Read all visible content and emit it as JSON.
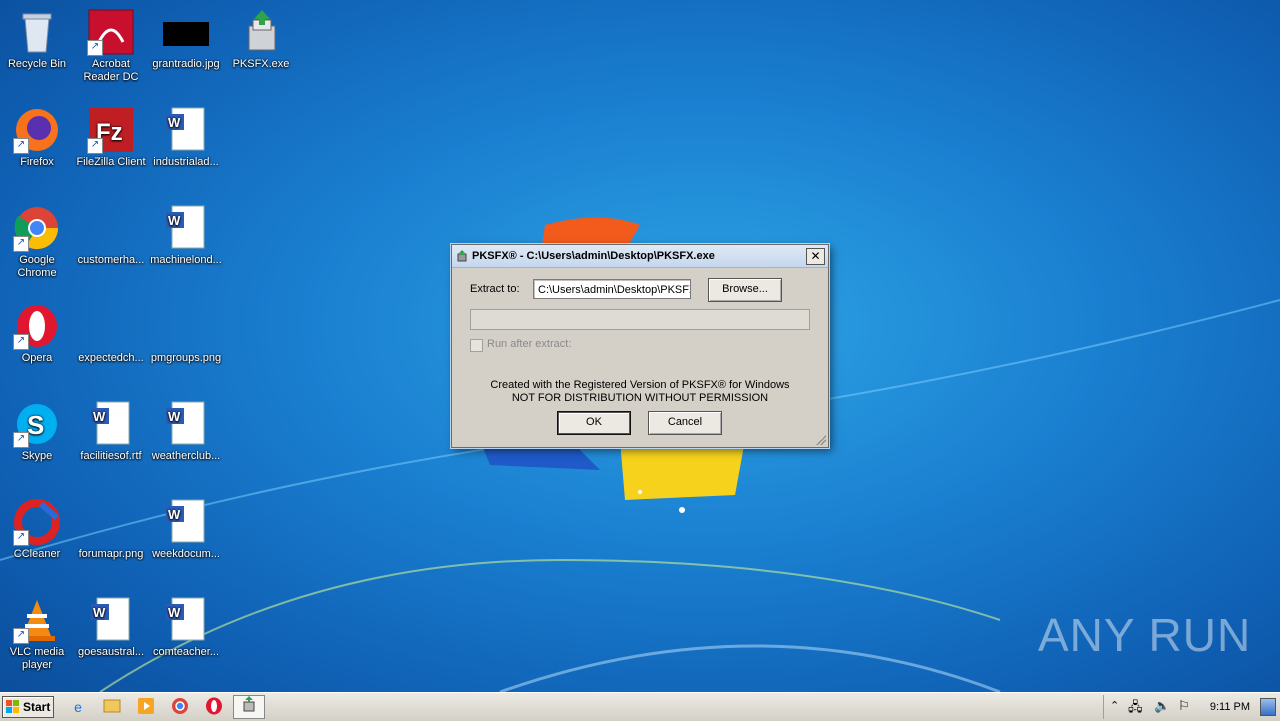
{
  "desktop": {
    "icons": [
      {
        "label": "Recycle Bin",
        "icon": "recycle-bin-icon"
      },
      {
        "label": "Acrobat Reader DC",
        "icon": "acrobat-icon"
      },
      {
        "label": "grantradio.jpg",
        "icon": "image-file-icon"
      },
      {
        "label": "PKSFX.exe",
        "icon": "installer-icon"
      },
      {
        "label": "Firefox",
        "icon": "firefox-icon"
      },
      {
        "label": "FileZilla Client",
        "icon": "filezilla-icon"
      },
      {
        "label": "industrialad...",
        "icon": "word-doc-icon"
      },
      {
        "label": "Google Chrome",
        "icon": "chrome-icon"
      },
      {
        "label": "customerha...",
        "icon": "blank-file-icon"
      },
      {
        "label": "machinelond...",
        "icon": "word-doc-icon"
      },
      {
        "label": "Opera",
        "icon": "opera-icon"
      },
      {
        "label": "expectedch...",
        "icon": "blank-file-icon"
      },
      {
        "label": "pmgroups.png",
        "icon": "blank-file-icon"
      },
      {
        "label": "Skype",
        "icon": "skype-icon"
      },
      {
        "label": "facilitiesof.rtf",
        "icon": "word-doc-icon"
      },
      {
        "label": "weatherclub...",
        "icon": "word-doc-icon"
      },
      {
        "label": "CCleaner",
        "icon": "ccleaner-icon"
      },
      {
        "label": "forumapr.png",
        "icon": "blank-file-icon"
      },
      {
        "label": "weekdocum...",
        "icon": "word-doc-icon"
      },
      {
        "label": "VLC media player",
        "icon": "vlc-icon"
      },
      {
        "label": "goesaustral...",
        "icon": "word-doc-icon"
      },
      {
        "label": "comteacher...",
        "icon": "word-doc-icon"
      }
    ]
  },
  "dialog": {
    "title": "PKSFX® - C:\\Users\\admin\\Desktop\\PKSFX.exe",
    "extract_label": "Extract to:",
    "extract_value": "C:\\Users\\admin\\Desktop\\PKSFX",
    "browse_label": "Browse...",
    "run_after_label": "Run after extract:",
    "run_after_checked": false,
    "progress": 0,
    "notice_line1": "Created with the Registered Version of PKSFX® for Windows",
    "notice_line2": "NOT FOR DISTRIBUTION WITHOUT PERMISSION",
    "ok_label": "OK",
    "cancel_label": "Cancel",
    "close_label": "✕"
  },
  "taskbar": {
    "start_label": "Start",
    "clock": "9:11 PM"
  },
  "watermark": "ANY RUN"
}
